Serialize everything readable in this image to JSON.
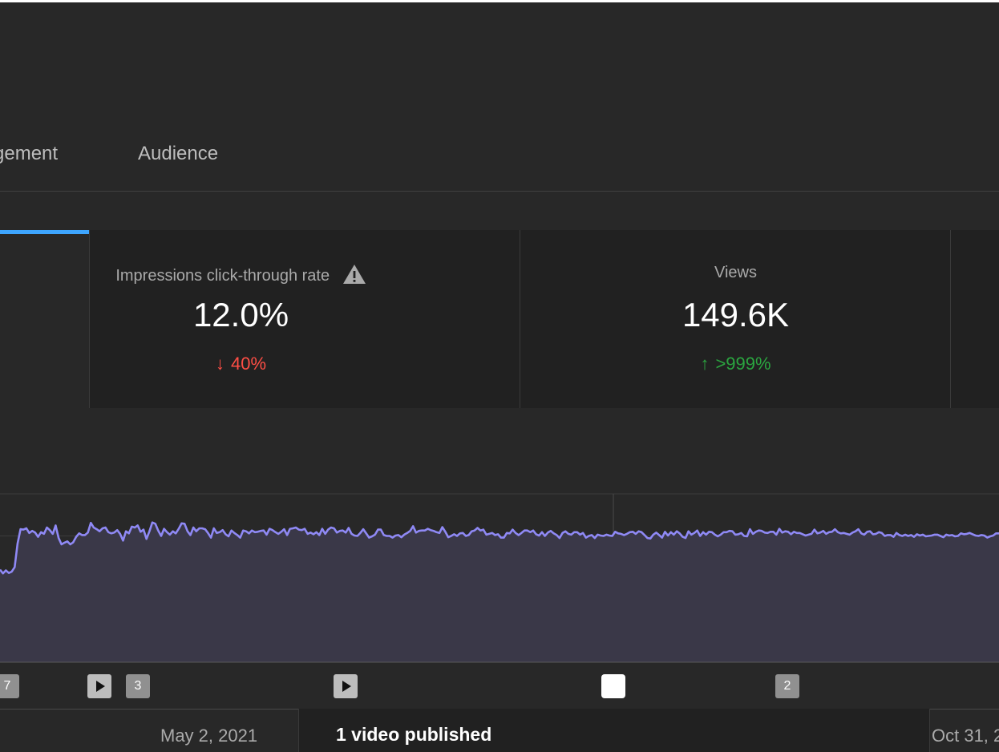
{
  "tabs": {
    "items": [
      {
        "label": "gement"
      },
      {
        "label": "Audience"
      }
    ]
  },
  "cards": {
    "ctr": {
      "title": "Impressions click-through rate",
      "value": "12.0%",
      "delta_arrow": "↓",
      "delta": "40%",
      "icon": "warning-icon"
    },
    "views": {
      "title": "Views",
      "value": "149.6K",
      "delta_arrow": "↑",
      "delta": ">999%"
    }
  },
  "colors": {
    "accent": "#3ea6ff",
    "line": "#8f89f5",
    "area": "#3a3848",
    "down": "#ff4e45",
    "up": "#2ba640"
  },
  "chart_data": {
    "type": "line",
    "series": [
      {
        "values": [
          220,
          211,
          218,
          212,
          215,
          226,
          282,
          316,
          315,
          318,
          307,
          312,
          308,
          298,
          309,
          305,
          320,
          314,
          305,
          325,
          295,
          280,
          284,
          287,
          280,
          285,
          298,
          306,
          302,
          302,
          308,
          331,
          320,
          316,
          311,
          318,
          320,
          309,
          306,
          308,
          314,
          305,
          289,
          311,
          306,
          322,
          320,
          325,
          310,
          315,
          293,
          311,
          332,
          329,
          313,
          300,
          317,
          309,
          303,
          311,
          306,
          317,
          330,
          329,
          311,
          302,
          320,
          311,
          318,
          318,
          316,
          307,
          296,
          318,
          307,
          309,
          314,
          304,
          299,
          313,
          307,
          302,
          296,
          313,
          311,
          306,
          313,
          309,
          310,
          312,
          313,
          303,
          317,
          314,
          309,
          305,
          310,
          316,
          302,
          317,
          318,
          320,
          315,
          314,
          317,
          305,
          308,
          304,
          309,
          302,
          317,
          305,
          315,
          320,
          318,
          308,
          312,
          313,
          308,
          319,
          305,
          301,
          300,
          307,
          316,
          306,
          296,
          299,
          303,
          315,
          315,
          302,
          300,
          300,
          296,
          301,
          302,
          297,
          303,
          307,
          312,
          323,
          308,
          312,
          313,
          313,
          317,
          314,
          312,
          309,
          307,
          321,
          310,
          297,
          300,
          304,
          300,
          306,
          307,
          300,
          302,
          311,
          313,
          319,
          313,
          315,
          303,
          305,
          307,
          302,
          304,
          296,
          296,
          307,
          306,
          315,
          307,
          302,
          307,
          313,
          313,
          309,
          313,
          304,
          301,
          309,
          300,
          308,
          312,
          306,
          302,
          295,
          307,
          311,
          305,
          303,
          309,
          309,
          303,
          307,
          296,
          300,
          302,
          295,
          303,
          301,
          300,
          303,
          301,
          300,
          310,
          306,
          305,
          302,
          305,
          309,
          310,
          305,
          311,
          309,
          302,
          295,
          294,
          303,
          308,
          302,
          296,
          310,
          301,
          309,
          303,
          311,
          306,
          298,
          295,
          311,
          303,
          307,
          313,
          300,
          309,
          303,
          310,
          309,
          303,
          299,
          303,
          309,
          309,
          312,
          311,
          303,
          304,
          307,
          300,
          299,
          316,
          305,
          310,
          313,
          312,
          308,
          307,
          310,
          310,
          303,
          317,
          308,
          311,
          310,
          304,
          310,
          307,
          307,
          304,
          301,
          303,
          305,
          315,
          306,
          308,
          312,
          305,
          309,
          310,
          316,
          309,
          306,
          307,
          305,
          303,
          308,
          311,
          316,
          306,
          303,
          310,
          311,
          304,
          305,
          309,
          307,
          300,
          302,
          302,
          298,
          307,
          302,
          300,
          303,
          300,
          302,
          298,
          304,
          301,
          303,
          299,
          300,
          301,
          303,
          303,
          300,
          297,
          303,
          301,
          302,
          299,
          300,
          306,
          304,
          305,
          307,
          304,
          301,
          300,
          302,
          301,
          296,
          299,
          301,
          306,
          306
        ]
      }
    ],
    "ylim": [
      0,
      4
    ],
    "grid": true
  },
  "markers": [
    {
      "kind": "count",
      "label": "7"
    },
    {
      "kind": "video",
      "label": ""
    },
    {
      "kind": "count",
      "label": "3"
    },
    {
      "kind": "video",
      "label": ""
    },
    {
      "kind": "selected",
      "label": ""
    },
    {
      "kind": "count",
      "label": "2"
    }
  ],
  "axis": {
    "labels": [
      "May 2, 2021",
      "Oct 31, 2"
    ]
  },
  "tooltip": {
    "text": "1 video published"
  }
}
